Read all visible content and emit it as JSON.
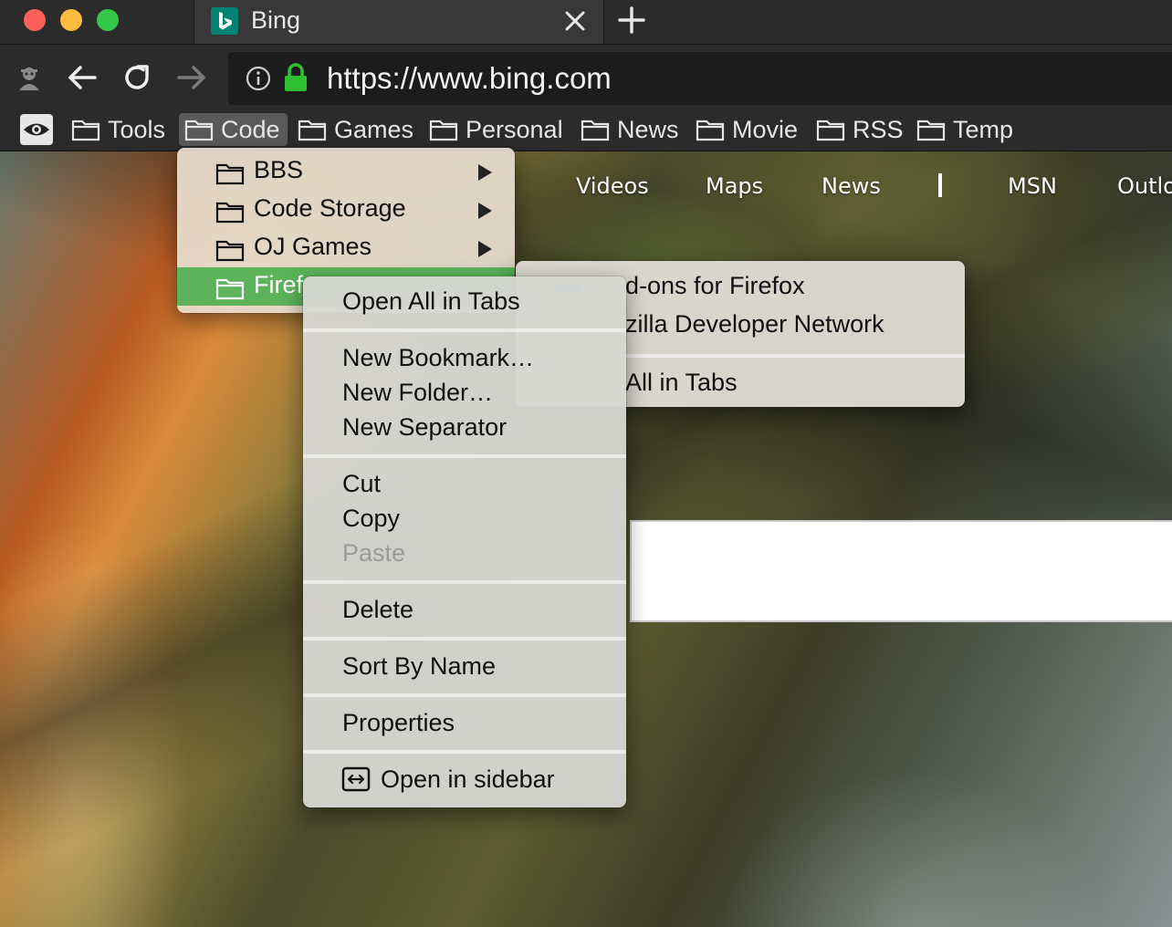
{
  "tab": {
    "title": "Bing"
  },
  "urlbar": {
    "url": "https://www.bing.com"
  },
  "bookmarks_toolbar": {
    "items": [
      {
        "label": "Tools"
      },
      {
        "label": "Code"
      },
      {
        "label": "Games"
      },
      {
        "label": "Personal"
      },
      {
        "label": "News"
      },
      {
        "label": "Movie"
      },
      {
        "label": "RSS"
      },
      {
        "label": "Temp"
      }
    ]
  },
  "page": {
    "nav": [
      "Videos",
      "Maps",
      "News",
      "MSN",
      "Outlo"
    ]
  },
  "code_menu": {
    "items": [
      {
        "label": "BBS",
        "icon": "folder-icon",
        "has_submenu": true
      },
      {
        "label": "Code Storage",
        "icon": "folder-icon",
        "has_submenu": true
      },
      {
        "label": "OJ Games",
        "icon": "folder-icon",
        "has_submenu": true
      },
      {
        "label": "Firef",
        "icon": "folder-icon",
        "highlighted": true
      }
    ]
  },
  "firefox_submenu": {
    "items": [
      {
        "label": "d-ons for Firefox"
      },
      {
        "label": "zilla Developer Network"
      },
      {
        "label": "All in Tabs"
      }
    ]
  },
  "context_menu": {
    "items": [
      {
        "label": "Open All in Tabs"
      },
      {
        "label": "New Bookmark…"
      },
      {
        "label": "New Folder…"
      },
      {
        "label": "New Separator"
      },
      {
        "label": "Cut"
      },
      {
        "label": "Copy"
      },
      {
        "label": "Paste",
        "disabled": true
      },
      {
        "label": "Delete"
      },
      {
        "label": "Sort By Name"
      },
      {
        "label": "Properties"
      },
      {
        "label": "Open in sidebar",
        "icon": "sidebar-icon"
      }
    ]
  },
  "colors": {
    "highlight": "#5cb35a",
    "bing_brand": "#008373",
    "lock": "#2ec02e"
  }
}
